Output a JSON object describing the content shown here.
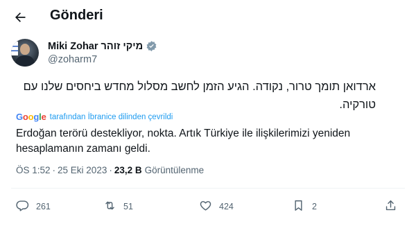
{
  "header": {
    "title": "Gönderi"
  },
  "author": {
    "name": "Miki Zohar מיקי זוהר",
    "handle": "@zoharm7"
  },
  "post": {
    "original_text": "ארדואן תומך טרור, נקודה. הגיע הזמן לחשב מסלול מחדש ביחסים שלנו עם טורקיה.",
    "translation_label": "tarafından İbranice dilinden çevrildi",
    "translated_text": "Erdoğan terörü destekliyor, nokta. Artık Türkiye ile ilişkilerimizi yeniden hesaplamanın zamanı geldi."
  },
  "meta": {
    "time": "ÖS 1:52",
    "separator": "·",
    "date": "25 Eki 2023",
    "views_count": "23,2 B",
    "views_label": "Görüntülenme"
  },
  "actions": {
    "replies": "261",
    "reposts": "51",
    "likes": "424",
    "bookmarks": "2"
  },
  "colors": {
    "accent": "#1d9bf0",
    "text_primary": "#0f1419",
    "text_secondary": "#536471",
    "divider": "#eff3f4"
  },
  "icons": [
    "back-arrow-icon",
    "verified-badge-icon",
    "google-logo",
    "reply-icon",
    "repost-icon",
    "like-icon",
    "bookmark-icon",
    "share-icon"
  ]
}
